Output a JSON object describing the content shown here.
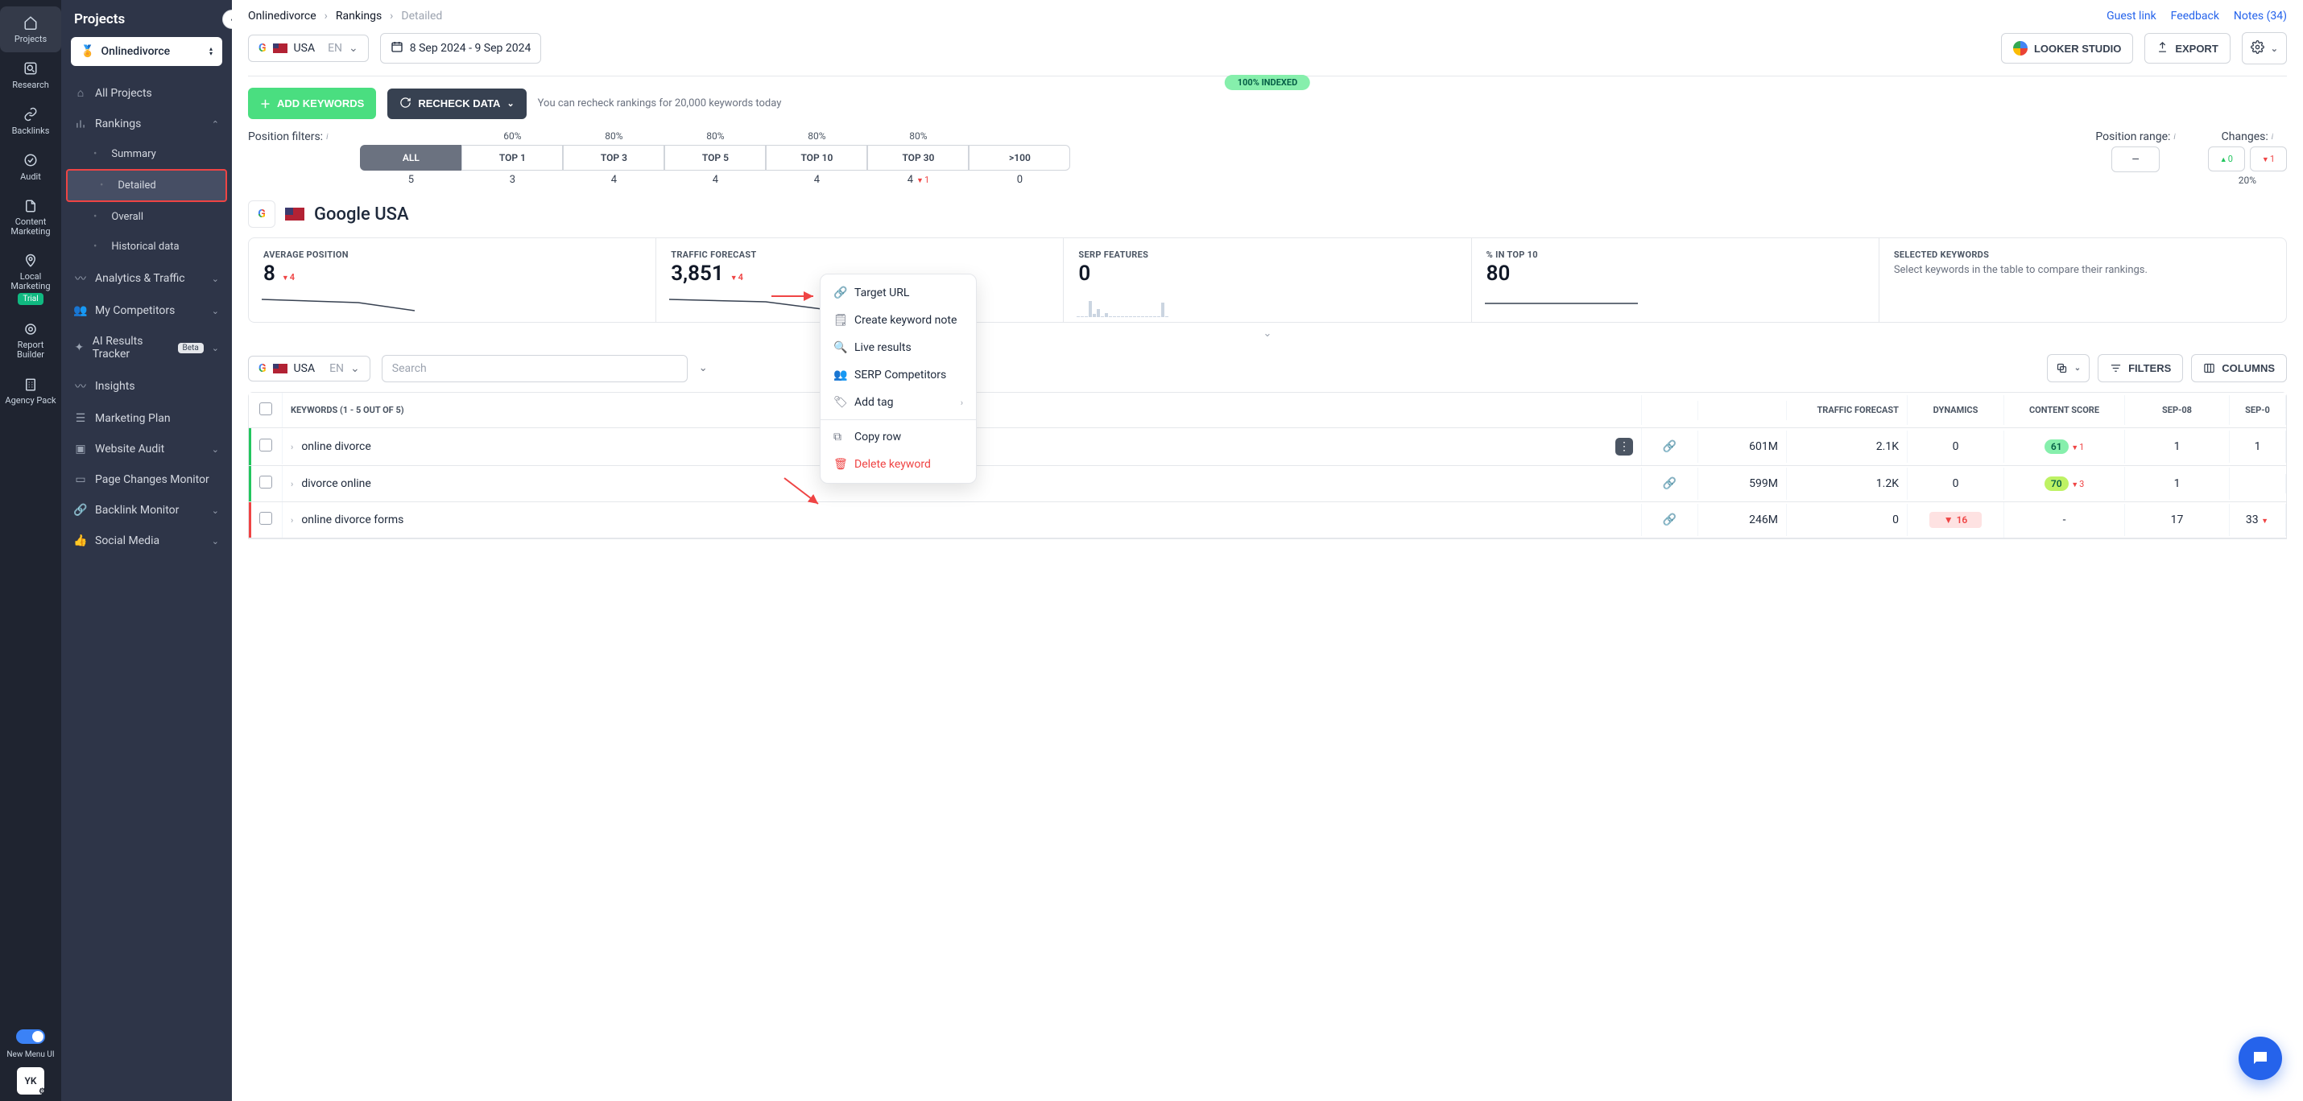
{
  "iconbar": {
    "items": [
      {
        "icon": "home",
        "label": "Projects",
        "active": true
      },
      {
        "icon": "search",
        "label": "Research"
      },
      {
        "icon": "link",
        "label": "Backlinks"
      },
      {
        "icon": "audit",
        "label": "Audit"
      },
      {
        "icon": "content",
        "label": "Content Marketing"
      },
      {
        "icon": "pin",
        "label": "Local Marketing",
        "trial": "Trial"
      },
      {
        "icon": "report",
        "label": "Report Builder"
      },
      {
        "icon": "agency",
        "label": "Agency Pack"
      }
    ],
    "toggle_label": "New Menu UI",
    "avatar": "YK"
  },
  "project_sidebar": {
    "heading": "Projects",
    "selected_project": "Onlinedivorce",
    "items": [
      {
        "icon": "home",
        "label": "All Projects"
      },
      {
        "icon": "chart",
        "label": "Rankings",
        "expandable": true,
        "expanded": true,
        "children": [
          {
            "label": "Summary"
          },
          {
            "label": "Detailed",
            "active": true
          },
          {
            "label": "Overall"
          },
          {
            "label": "Historical data"
          }
        ]
      },
      {
        "icon": "pulse",
        "label": "Analytics & Traffic",
        "expandable": true
      },
      {
        "icon": "people",
        "label": "My Competitors",
        "expandable": true
      },
      {
        "icon": "ai",
        "label": "AI Results Tracker",
        "badge": "Beta",
        "expandable": true
      },
      {
        "icon": "bulb",
        "label": "Insights"
      },
      {
        "icon": "plan",
        "label": "Marketing Plan"
      },
      {
        "icon": "waudit",
        "label": "Website Audit",
        "expandable": true
      },
      {
        "icon": "monitor",
        "label": "Page Changes Monitor"
      },
      {
        "icon": "bl",
        "label": "Backlink Monitor",
        "expandable": true
      },
      {
        "icon": "thumb",
        "label": "Social Media",
        "expandable": true
      }
    ]
  },
  "breadcrumbs": [
    "Onlinedivorce",
    "Rankings",
    "Detailed"
  ],
  "top_links": {
    "guest": "Guest link",
    "feedback": "Feedback",
    "notes": "Notes (34)"
  },
  "region_picker": {
    "country": "USA",
    "lang": "EN"
  },
  "date_range": "8 Sep 2024 - 9 Sep 2024",
  "buttons": {
    "looker": "LOOKER STUDIO",
    "export": "EXPORT",
    "add_kw": "ADD KEYWORDS",
    "recheck": "RECHECK DATA",
    "filters": "FILTERS",
    "columns": "COLUMNS"
  },
  "index_badge": "100% INDEXED",
  "recheck_hint": "You can recheck rankings for 20,000 keywords today",
  "position_filters": {
    "label": "Position filters:",
    "columns": [
      {
        "pct": "",
        "chip": "ALL",
        "count": "5",
        "active": true
      },
      {
        "pct": "60%",
        "chip": "TOP 1",
        "count": "3"
      },
      {
        "pct": "80%",
        "chip": "TOP 3",
        "count": "4"
      },
      {
        "pct": "80%",
        "chip": "TOP 5",
        "count": "4"
      },
      {
        "pct": "80%",
        "chip": "TOP 10",
        "count": "4"
      },
      {
        "pct": "80%",
        "chip": "TOP 30",
        "count": "4",
        "delta": "1"
      },
      {
        "pct": "",
        "chip": ">100",
        "count": "0"
      }
    ],
    "range_label": "Position range:",
    "range_value": "—",
    "changes_label": "Changes:",
    "changes_up": "0",
    "changes_down": "1",
    "changes_pct": "20%"
  },
  "engine_title": "Google USA",
  "stats": {
    "avg_position": {
      "label": "AVERAGE POSITION",
      "value": "8",
      "delta": "4"
    },
    "traffic": {
      "label": "TRAFFIC FORECAST",
      "value": "3,851",
      "delta": "4"
    },
    "serp": {
      "label": "SERP FEATURES",
      "value": "0"
    },
    "pct_top10": {
      "label": "% IN TOP 10",
      "value": "80"
    },
    "selected": {
      "label": "SELECTED KEYWORDS",
      "hint": "Select keywords in the table to compare their rankings."
    }
  },
  "context_menu": [
    {
      "icon": "link",
      "label": "Target URL"
    },
    {
      "icon": "note",
      "label": "Create keyword note"
    },
    {
      "icon": "search",
      "label": "Live results"
    },
    {
      "icon": "people",
      "label": "SERP Competitors"
    },
    {
      "icon": "tag",
      "label": "Add tag",
      "submenu": true
    },
    {
      "divider": true
    },
    {
      "icon": "copy",
      "label": "Copy row"
    },
    {
      "icon": "trash",
      "label": "Delete keyword",
      "danger": true
    }
  ],
  "table": {
    "search_placeholder": "Search",
    "kw_header": "KEYWORDS (1 - 5 OUT OF 5)",
    "columns": [
      "",
      "",
      "TRAFFIC FORECAST",
      "DYNAMICS",
      "CONTENT SCORE",
      "SEP-08",
      "SEP-0"
    ],
    "vol_label": "",
    "rows": [
      {
        "stripe": "green",
        "kw": "online divorce",
        "vol": "601M",
        "tf": "2.1K",
        "dyn": "0",
        "cs": "61",
        "cs_class": "g",
        "cs_delta": "1",
        "s08": "1",
        "s09": "1",
        "kebab": true
      },
      {
        "stripe": "green",
        "kw": "divorce online",
        "vol": "599M",
        "tf": "1.2K",
        "dyn": "0",
        "cs": "70",
        "cs_class": "y",
        "cs_delta": "3",
        "s08": "1",
        "s09": ""
      },
      {
        "stripe": "red",
        "kw": "online divorce forms",
        "vol": "246M",
        "tf": "0",
        "dyn_chip": "16",
        "cs": "-",
        "s08": "17",
        "s09": "33",
        "s09_delta": true
      }
    ]
  },
  "table_region": {
    "country": "USA",
    "lang": "EN"
  }
}
